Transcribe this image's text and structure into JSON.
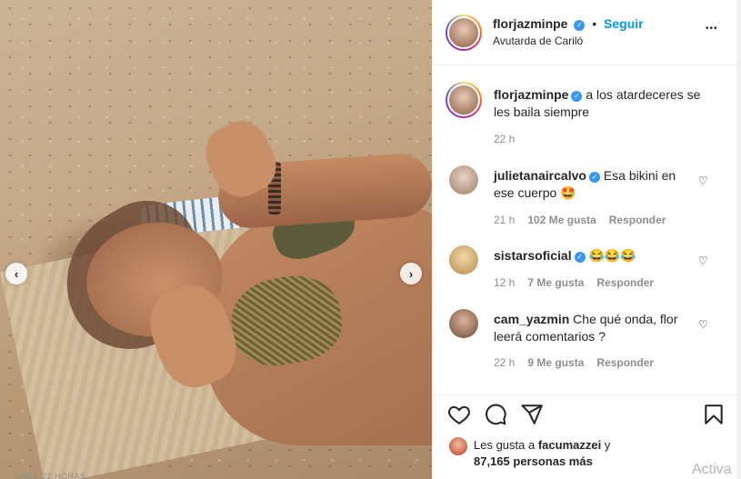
{
  "post": {
    "username": "florjazminpe",
    "follow_label": "Seguir",
    "dot": "•",
    "location": "Avutarda de Cariló",
    "more_label": "•••",
    "caption": "a los atardeceres se les baila siempre",
    "caption_time": "22 h"
  },
  "comments": [
    {
      "username": "julietanaircalvo",
      "text": "Esa bikini en ese cuerpo 🤩",
      "time": "21 h",
      "likes": "102 Me gusta",
      "reply": "Responder"
    },
    {
      "username": "sistarsoficial",
      "text": "😂😂😂",
      "time": "12 h",
      "likes": "7 Me gusta",
      "reply": "Responder"
    },
    {
      "username": "cam_yazmin",
      "text": "Che qué onda, flor leerá comentarios ?",
      "time": "22 h",
      "likes": "9 Me gusta",
      "reply": "Responder"
    }
  ],
  "likes_summary": {
    "prefix": "Les gusta a",
    "user": "facumazzei",
    "connector": "y",
    "count": "87,165 personas más"
  },
  "post_date": "HACE 22 HORAS",
  "watermark": "Activa",
  "icons": {
    "prev": "chevron-left-icon",
    "next": "chevron-right-icon",
    "like": "heart-icon",
    "comment": "comment-bubble-icon",
    "share": "paper-plane-icon",
    "save": "bookmark-icon"
  },
  "colors": {
    "link": "#0095f6",
    "verified": "#3897f0",
    "border": "#efefef",
    "muted": "#8e8e8e"
  }
}
